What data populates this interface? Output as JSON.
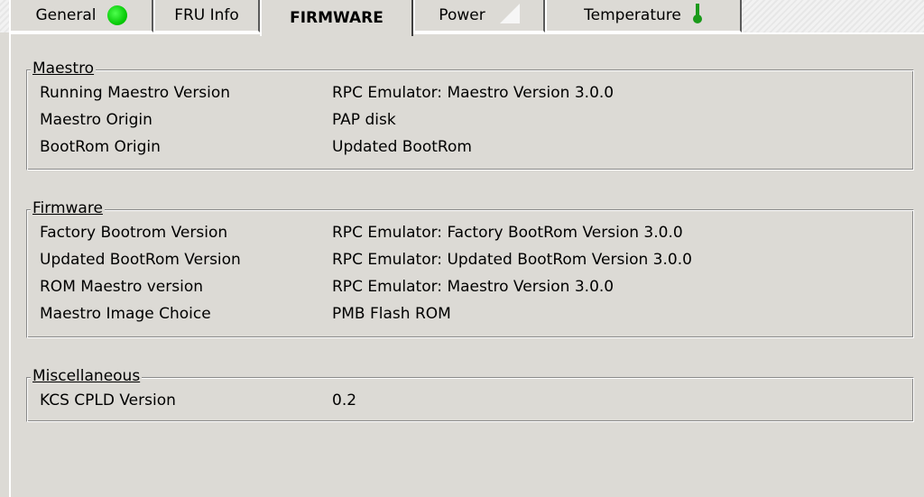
{
  "tabs": [
    {
      "label": "General",
      "icon": "green-status-dot-icon"
    },
    {
      "label": "FRU Info",
      "icon": null
    },
    {
      "label": "FIRMWARE",
      "icon": null,
      "active": true
    },
    {
      "label": "Power",
      "icon": "power-status-icon"
    },
    {
      "label": "Temperature",
      "icon": "thermometer-icon"
    }
  ],
  "maestro": {
    "title": "Maestro",
    "rows": [
      {
        "key": "Running Maestro Version",
        "value": "RPC Emulator: Maestro Version 3.0.0"
      },
      {
        "key": "Maestro Origin",
        "value": "PAP disk"
      },
      {
        "key": "BootRom Origin",
        "value": "Updated BootRom"
      }
    ]
  },
  "firmware": {
    "title": "Firmware",
    "rows": [
      {
        "key": "Factory Bootrom Version",
        "value": "RPC Emulator: Factory BootRom Version 3.0.0"
      },
      {
        "key": "Updated BootRom Version",
        "value": "RPC Emulator: Updated BootRom Version 3.0.0"
      },
      {
        "key": "ROM Maestro version",
        "value": "RPC Emulator: Maestro Version 3.0.0"
      },
      {
        "key": "Maestro Image Choice",
        "value": "PMB Flash ROM"
      }
    ]
  },
  "miscellaneous": {
    "title": "Miscellaneous",
    "rows": [
      {
        "key": "KCS CPLD Version",
        "value": "0.2"
      }
    ]
  },
  "colors": {
    "status_ok": "#00c400",
    "thermometer": "#1a9a1a",
    "panel_bg": "#dcdad5"
  }
}
